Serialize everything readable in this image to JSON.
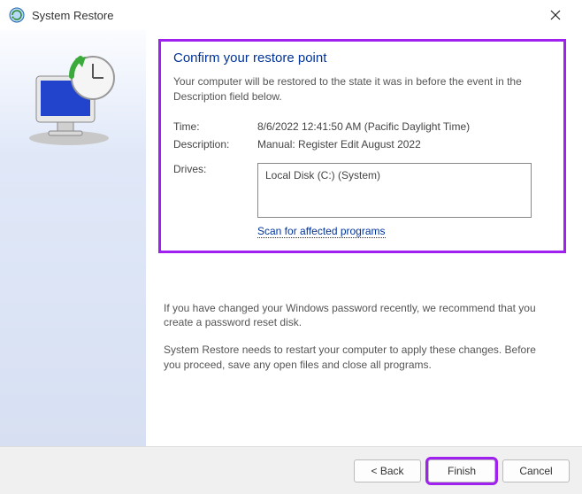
{
  "titlebar": {
    "title": "System Restore"
  },
  "main": {
    "heading": "Confirm your restore point",
    "description": "Your computer will be restored to the state it was in before the event in the Description field below.",
    "time_label": "Time:",
    "time_value": "8/6/2022 12:41:50 AM (Pacific Daylight Time)",
    "desc_label": "Description:",
    "desc_value": "Manual: Register Edit August 2022",
    "drives_label": "Drives:",
    "drives_value": "Local Disk (C:) (System)",
    "scan_link": "Scan for affected programs",
    "note1": "If you have changed your Windows password recently, we recommend that you create a password reset disk.",
    "note2": "System Restore needs to restart your computer to apply these changes. Before you proceed, save any open files and close all programs."
  },
  "footer": {
    "back": "< Back",
    "finish": "Finish",
    "cancel": "Cancel"
  }
}
